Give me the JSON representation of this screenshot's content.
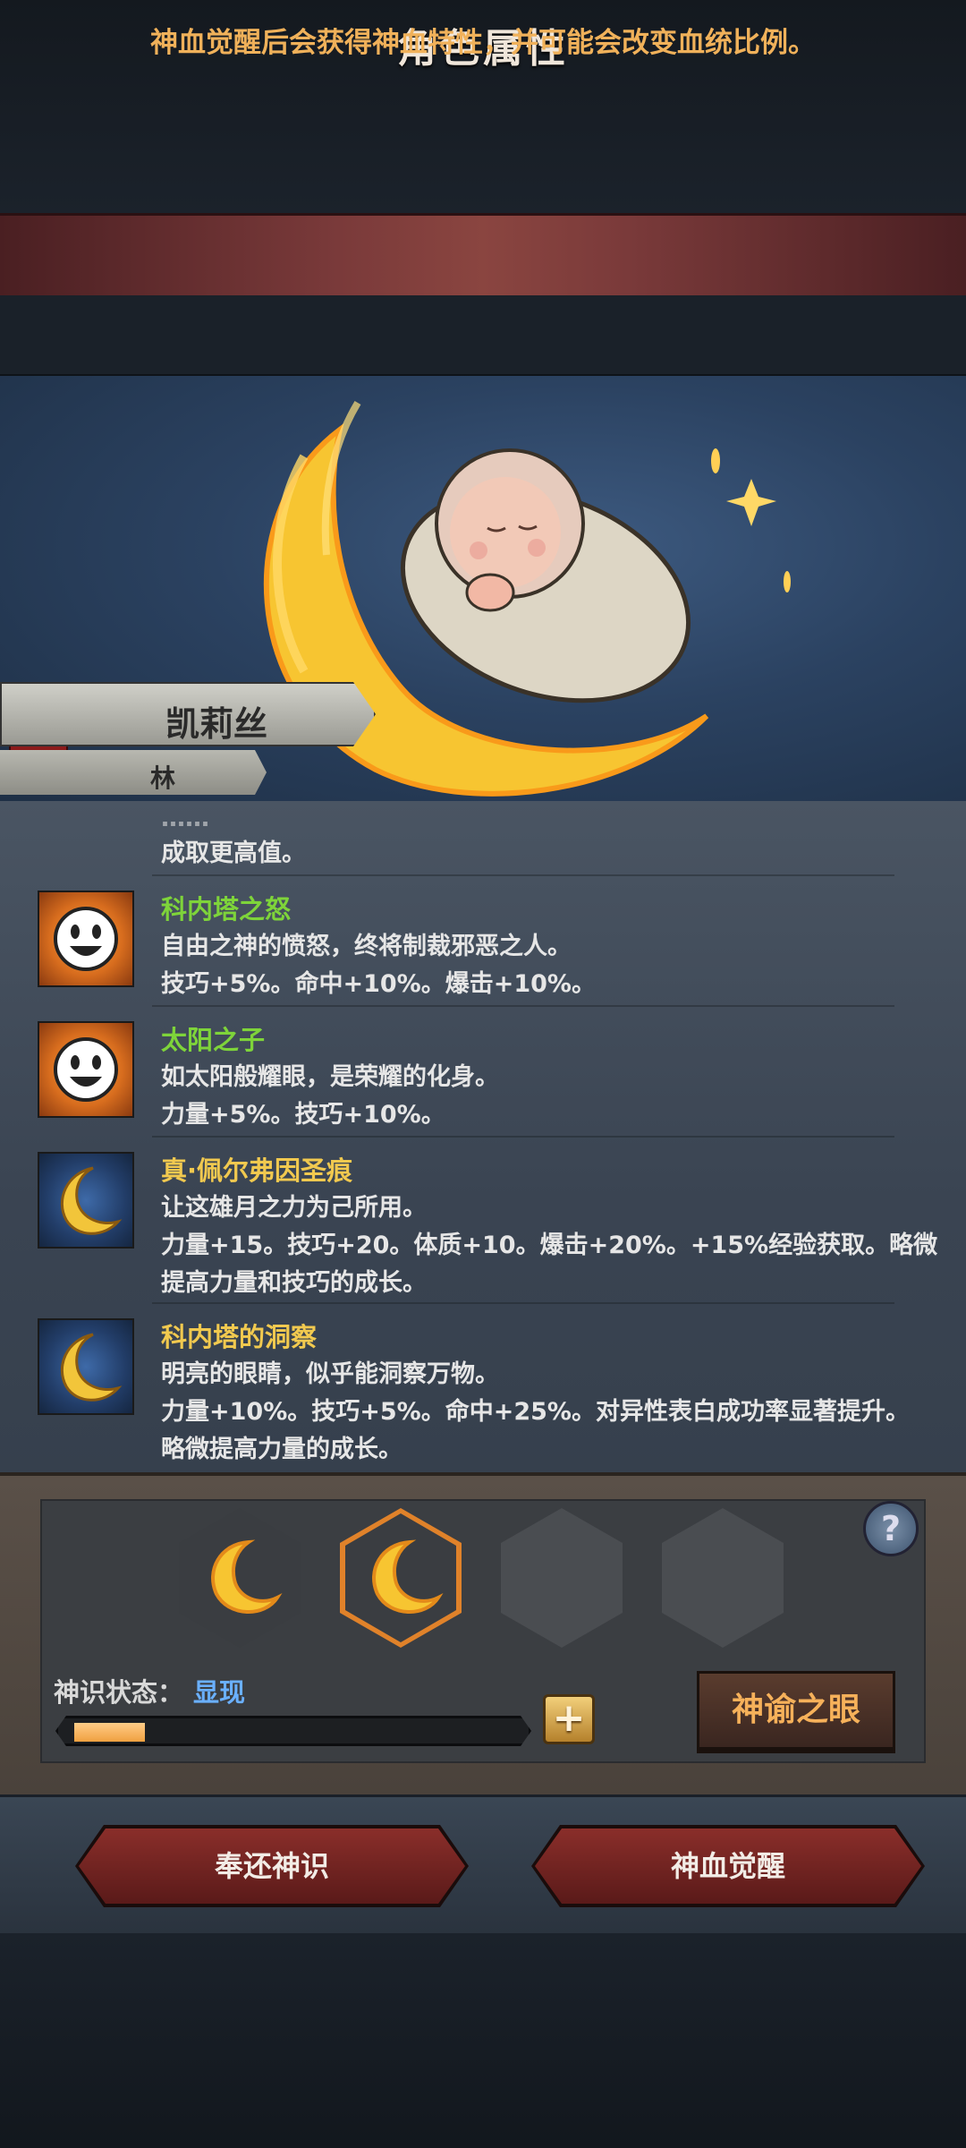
{
  "header": {
    "title": "角色属性",
    "subtitle": "神血觉醒后会获得神血特性，并可能会改变血统比例。"
  },
  "character": {
    "name": "凯莉丝",
    "surname": "林"
  },
  "traits": {
    "partial_text": "成取更高值。",
    "items": [
      {
        "name": "科内塔之怒",
        "icon": "sun-face-icon",
        "desc": "自由之神的愤怒，终将制裁邪恶之人。",
        "effect": "技巧+5%。命中+10%。爆击+10%。"
      },
      {
        "name": "太阳之子",
        "icon": "sun-face-icon",
        "desc": "如太阳般耀眼，是荣耀的化身。",
        "effect": "力量+5%。技巧+10%。"
      },
      {
        "name": "真·佩尔弗因圣痕",
        "icon": "crescent-moon-icon",
        "desc": "让这雄月之力为己所用。",
        "effect": "力量+15。技巧+20。体质+10。爆击+20%。+15%经验获取。略微",
        "effect2": "提高力量和技巧的成长。"
      },
      {
        "name": "科内塔的洞察",
        "icon": "crescent-moon-icon",
        "desc": "明亮的眼睛，似乎能洞察万物。",
        "effect": "力量+10%。技巧+5%。命中+25%。对异性表白成功率显著提升。",
        "effect2": "略微提高力量的成长。"
      }
    ]
  },
  "oracle": {
    "state_label": "神识状态：",
    "state_value": "显现",
    "progress": 0.16,
    "plus_label": "+",
    "oracle_button": "神谕之眼",
    "help_label": "?"
  },
  "footer": {
    "return_button": "奉还神识",
    "awaken_button": "神血觉醒"
  },
  "colors": {
    "accent_orange": "#f0b15a",
    "trait_green": "#7ed43a",
    "trait_gold": "#f1c94f",
    "state_blue": "#6ab0ff"
  }
}
